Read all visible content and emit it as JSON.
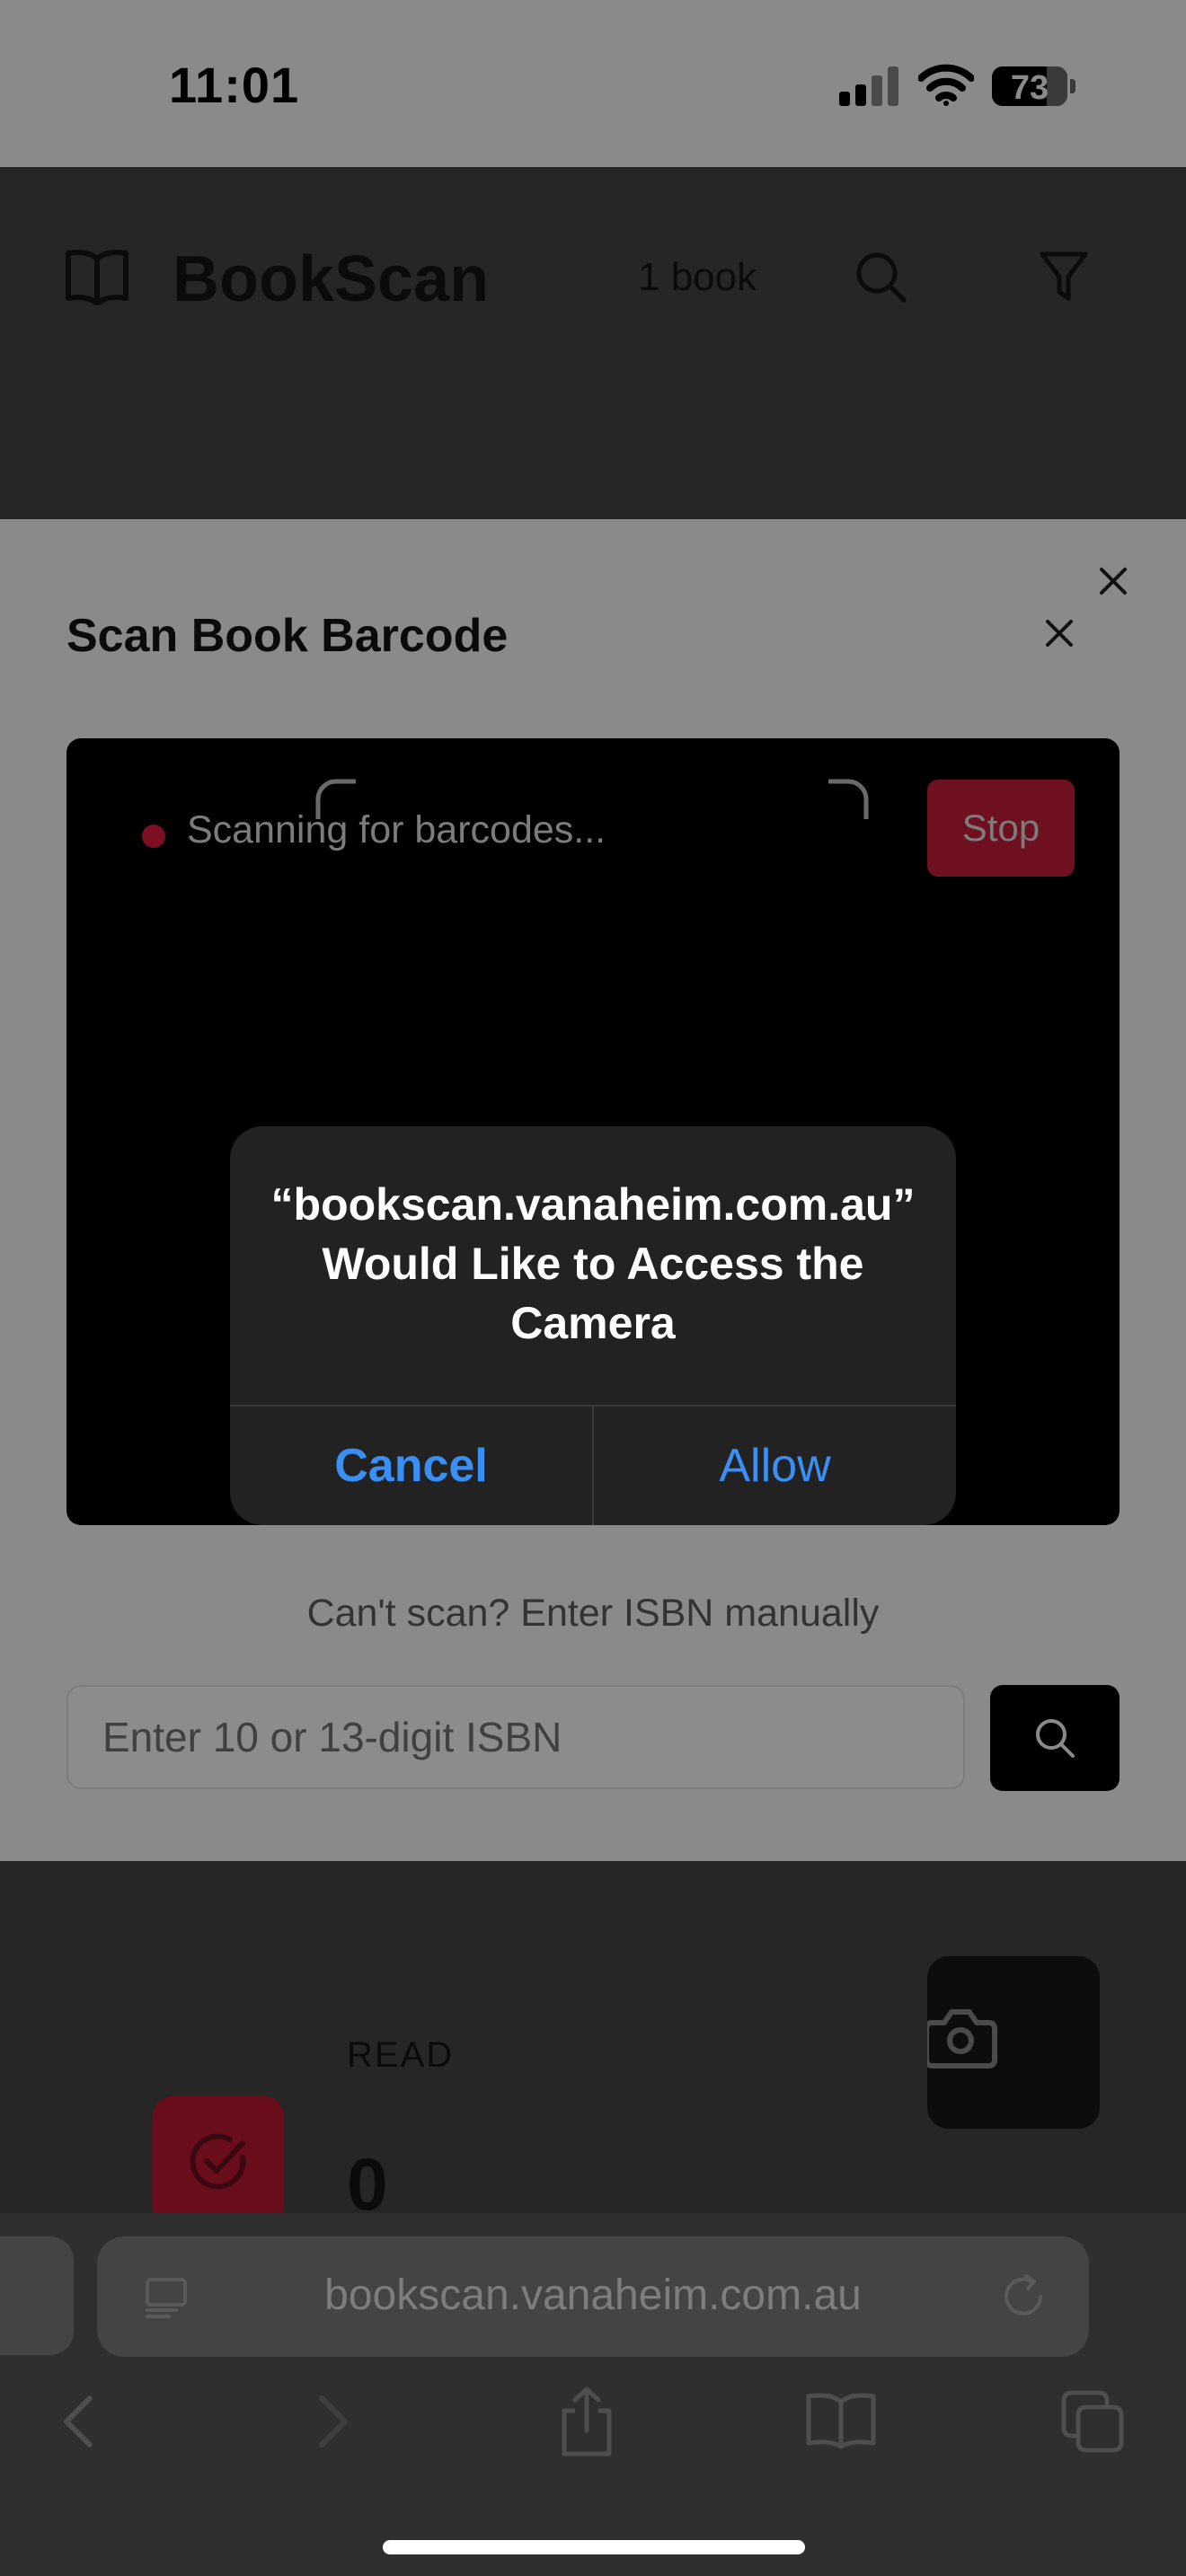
{
  "status_bar": {
    "time": "11:01",
    "battery_percent": "73",
    "battery_level": 0.73,
    "icons": [
      "cellular-signal-icon",
      "wifi-icon",
      "battery-icon"
    ]
  },
  "header": {
    "app_name": "BookScan",
    "book_count": "1 book",
    "icons": [
      "book-logo-icon",
      "search-icon",
      "filter-icon"
    ]
  },
  "scan_modal": {
    "title": "Scan Book Barcode",
    "scanning_status": "Scanning for barcodes...",
    "stop_label": "Stop",
    "manual_prompt": "Can't scan? Enter ISBN manually",
    "isbn_placeholder": "Enter 10 or 13-digit ISBN",
    "isbn_value": ""
  },
  "alert": {
    "title": "“bookscan.vanaheim.com.au” Would Like to Access the Camera",
    "cancel_label": "Cancel",
    "allow_label": "Allow"
  },
  "stats": {
    "read_label": "READ",
    "read_count": "0"
  },
  "browser": {
    "address": "bookscan.vanaheim.com.au",
    "toolbar_icons": [
      "back-icon",
      "forward-icon",
      "share-icon",
      "bookmarks-icon",
      "tabs-icon"
    ]
  },
  "colors": {
    "alert_button": "#3a8ff5",
    "stop_button": "#6e1020",
    "dim_overlay": "#8a8a8a"
  }
}
